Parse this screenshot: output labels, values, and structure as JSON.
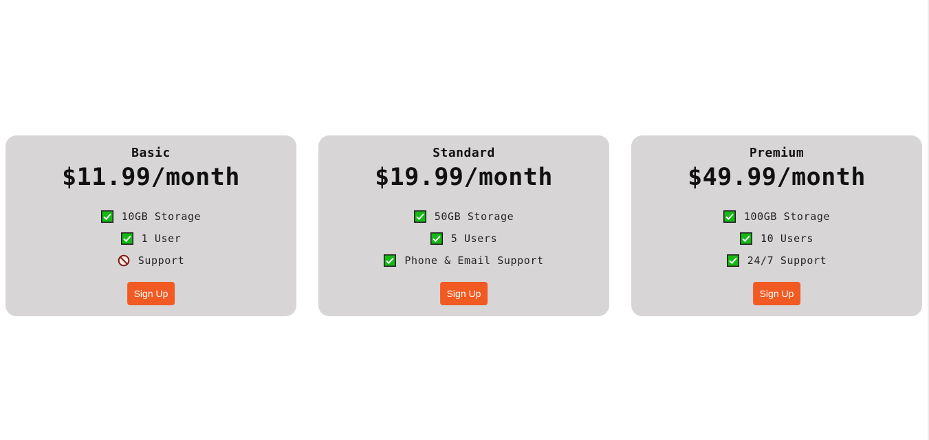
{
  "plans": [
    {
      "name": "Basic",
      "price": "$11.99/month",
      "features": [
        {
          "icon": "checkmark-icon",
          "text": "10GB Storage"
        },
        {
          "icon": "checkmark-icon",
          "text": "1 User"
        },
        {
          "icon": "prohibited-icon",
          "text": "Support"
        }
      ],
      "button_label": "Sign Up"
    },
    {
      "name": "Standard",
      "price": "$19.99/month",
      "features": [
        {
          "icon": "checkmark-icon",
          "text": "50GB Storage"
        },
        {
          "icon": "checkmark-icon",
          "text": "5 Users"
        },
        {
          "icon": "checkmark-icon",
          "text": "Phone & Email Support"
        }
      ],
      "button_label": "Sign Up"
    },
    {
      "name": "Premium",
      "price": "$49.99/month",
      "features": [
        {
          "icon": "checkmark-icon",
          "text": "100GB Storage"
        },
        {
          "icon": "checkmark-icon",
          "text": "10 Users"
        },
        {
          "icon": "checkmark-icon",
          "text": "24/7 Support"
        }
      ],
      "button_label": "Sign Up"
    }
  ],
  "colors": {
    "page_background": "#ffffff",
    "card_background": "#d7d5d6",
    "button_background": "#f15a22",
    "button_text": "#ffffff",
    "check_green": "#16b716",
    "prohibited_red": "#7a1a12"
  }
}
